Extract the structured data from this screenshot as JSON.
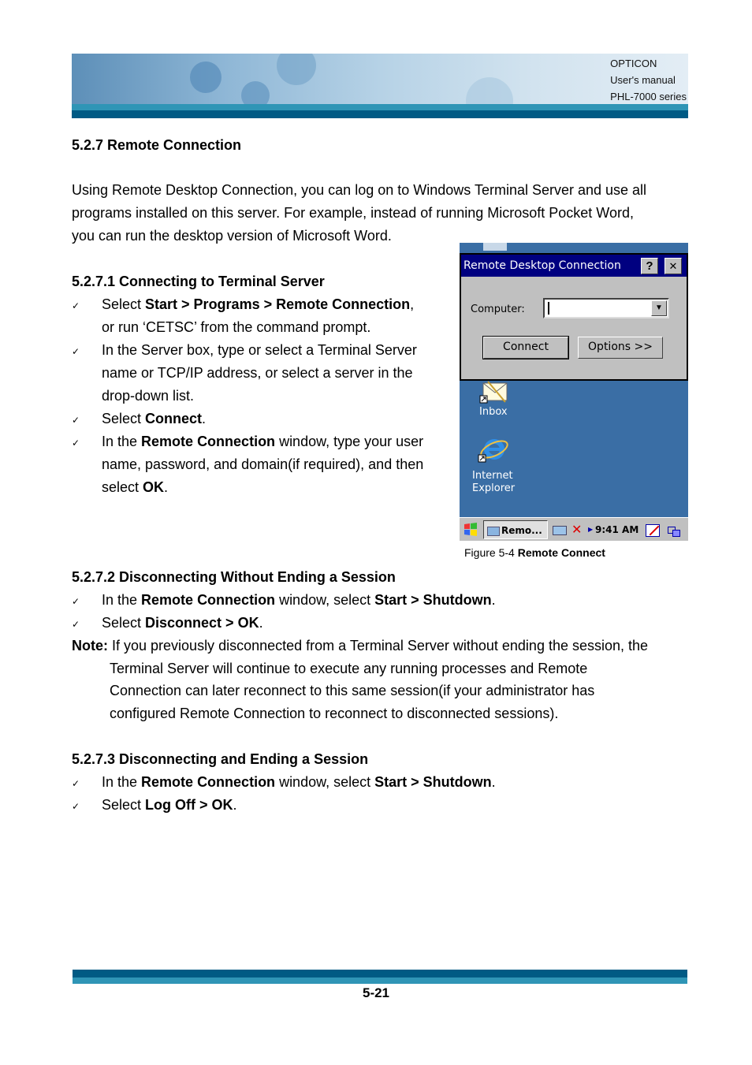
{
  "header": {
    "line1": "OPTICON",
    "line2": "User's manual",
    "line3": "PHL-7000 series"
  },
  "section": {
    "title": "5.2.7 Remote Connection",
    "intro_lines": [
      "Using Remote Desktop Connection, you can log on to Windows Terminal Server and use all",
      "programs installed on this server. For example, instead of running Microsoft Pocket Word,",
      "you can run the desktop version of Microsoft Word."
    ]
  },
  "sub1": {
    "title": "5.2.7.1 Connecting to Terminal Server",
    "bullet_glyph": "✓",
    "b1_pre": "Select ",
    "b1_bold": "Start > Programs > Remote Connection",
    "b1_post": ",",
    "b1_line2": "or run ‘CETSC’ from the command prompt.",
    "b2_line1": "In the Server box, type or select a Terminal Server",
    "b2_line2": "name or TCP/IP address, or select a server in the",
    "b2_line3": "drop-down list.",
    "b3_pre": "Select ",
    "b3_bold": "Connect",
    "b3_post": ".",
    "b4_pre": "In the ",
    "b4_bold": "Remote Connection",
    "b4_post": " window, type your user",
    "b4_line2": "name, password, and domain(if required), and then",
    "b4_line3_pre": "select ",
    "b4_line3_bold": "OK",
    "b4_line3_post": "."
  },
  "figure": {
    "dialog_title": "Remote Desktop Connection",
    "help_btn": "?",
    "close_btn": "✕",
    "computer_label": "Computer:",
    "computer_value": "",
    "dropdown_glyph": "▼",
    "connect_btn": "Connect",
    "options_btn": "Options >>",
    "icons": [
      {
        "label": "Inbox"
      },
      {
        "label_line1": "Internet",
        "label_line2": "Explorer"
      }
    ],
    "taskbar": {
      "task_label": "Remo...",
      "time": "9:41 AM"
    },
    "caption_pre": "Figure 5-4 ",
    "caption_bold": "Remote Connect"
  },
  "sub2": {
    "title": "5.2.7.2 Disconnecting Without Ending a Session",
    "b1_pre": "In the ",
    "b1_bold1": "Remote Connection",
    "b1_mid": " window, select ",
    "b1_bold2": "Start > Shutdown",
    "b1_post": ".",
    "b2_pre": "Select ",
    "b2_bold": "Disconnect > OK",
    "b2_post": ".",
    "note_label": "Note:",
    "note_line1": " If you previously disconnected from a Terminal Server without ending the session, the",
    "note_line2": "Terminal Server will continue to execute any running processes and Remote",
    "note_line3": "Connection can later reconnect to this same session(if your administrator has",
    "note_line4": "configured Remote Connection to reconnect to disconnected sessions)."
  },
  "sub3": {
    "title": "5.2.7.3 Disconnecting and Ending a Session",
    "b1_pre": "In the ",
    "b1_bold1": "Remote Connection",
    "b1_mid": " window, select ",
    "b1_bold2": "Start > Shutdown",
    "b1_post": ".",
    "b2_pre": "Select ",
    "b2_bold": "Log Off > OK",
    "b2_post": "."
  },
  "footer": {
    "page_number": "5-21"
  }
}
